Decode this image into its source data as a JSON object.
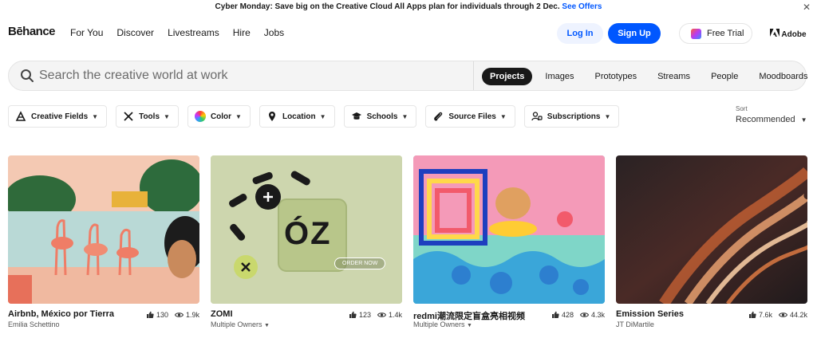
{
  "promo": {
    "text": "Cyber Monday: Save big on the Creative Cloud All Apps plan for individuals through 2 Dec.",
    "link": "See Offers",
    "close": "✕"
  },
  "header": {
    "logo": "Bēhance",
    "nav": [
      "For You",
      "Discover",
      "Livestreams",
      "Hire",
      "Jobs"
    ],
    "login": "Log In",
    "signup": "Sign Up",
    "trial": "Free Trial",
    "adobe": "Adobe"
  },
  "search": {
    "placeholder": "Search the creative world at work",
    "tabs": [
      "Projects",
      "Images",
      "Prototypes",
      "Streams",
      "People",
      "Moodboards"
    ],
    "active_tab": "Projects"
  },
  "filters": [
    "Creative Fields",
    "Tools",
    "Color",
    "Location",
    "Schools",
    "Source Files",
    "Subscriptions"
  ],
  "sort": {
    "label": "Sort",
    "value": "Recommended"
  },
  "projects": [
    {
      "title": "Airbnb, México por Tierra",
      "owner": "Emilia Schettino",
      "likes": "130",
      "views": "1.9k"
    },
    {
      "title": "ZOMI",
      "owner": "Multiple Owners",
      "likes": "123",
      "views": "1.4k",
      "thumb_text": "ÓZ",
      "thumb_button": "ORDER NOW"
    },
    {
      "title": "redmi潮流限定盲盒亮相视频",
      "owner": "Multiple Owners",
      "likes": "428",
      "views": "4.3k"
    },
    {
      "title": "Emission Series",
      "owner": "JT DiMartile",
      "likes": "7.6k",
      "views": "44.2k"
    }
  ],
  "colors": {
    "accent": "#0057ff",
    "dark": "#191919"
  }
}
